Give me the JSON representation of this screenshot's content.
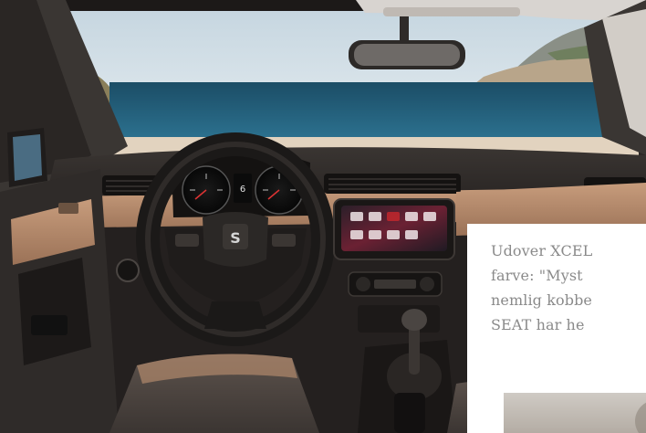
{
  "hero": {
    "alt": "",
    "colors": {
      "sky": "#d7e3ea",
      "sea": "#1f5f7a",
      "beach": "#e4d7c5",
      "dashboard": "#2a2624",
      "trim": "#b98e6f",
      "screen_accent": "#c1272d"
    },
    "cluster": {
      "gear": "6"
    },
    "steering_logo": "S"
  },
  "article": {
    "lines": [
      "Udover XCEL",
      "farve: \"Myst",
      "nemlig kobbe",
      "SEAT har he"
    ]
  }
}
